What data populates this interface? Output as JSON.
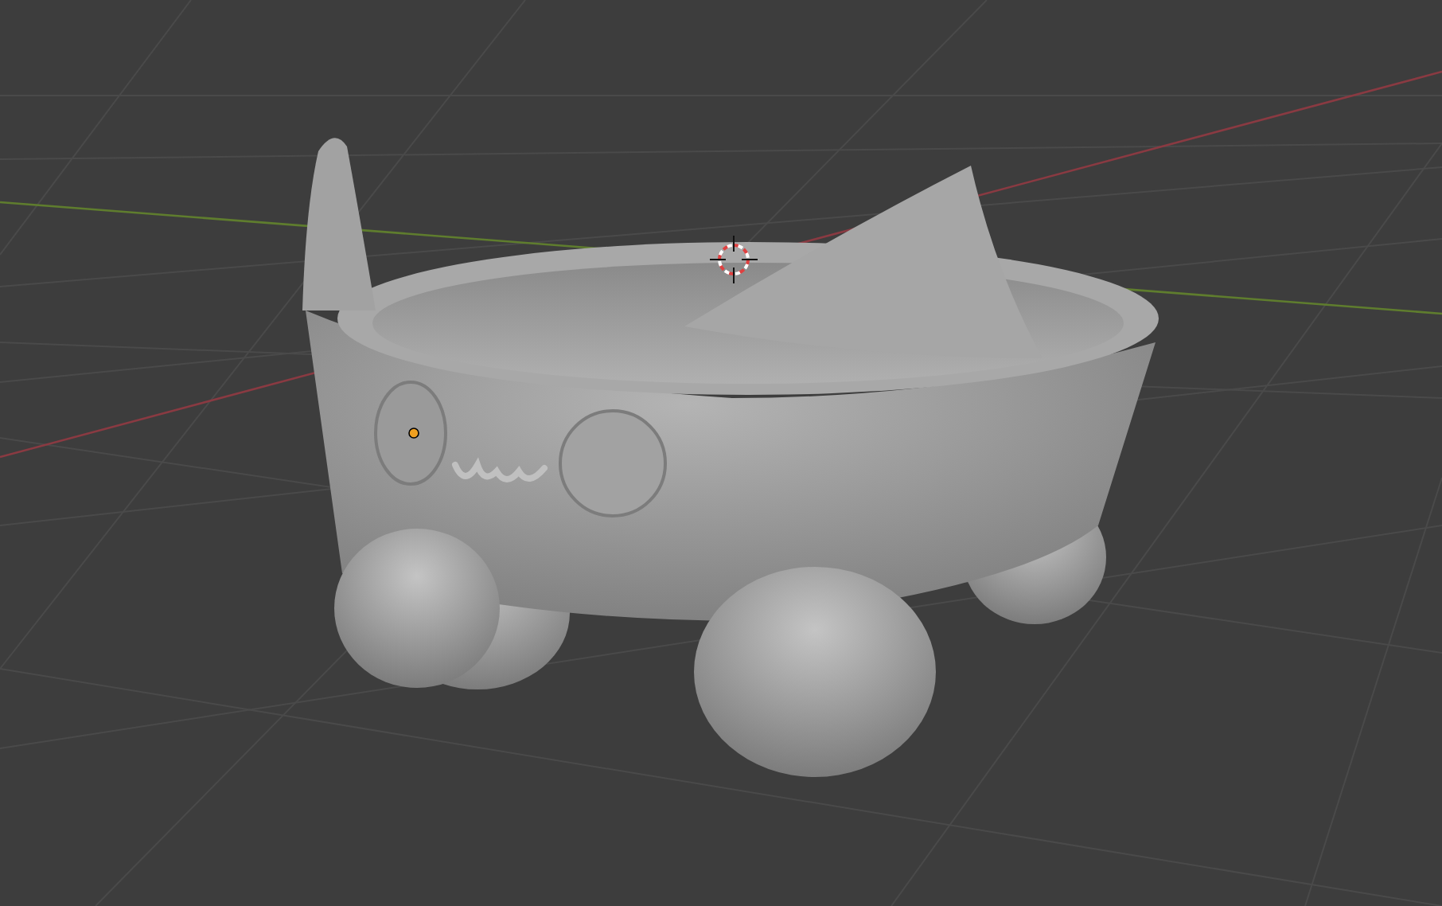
{
  "viewport": {
    "show_grid": true,
    "show_axes": true,
    "show_cursor": true,
    "show_origin": true
  }
}
